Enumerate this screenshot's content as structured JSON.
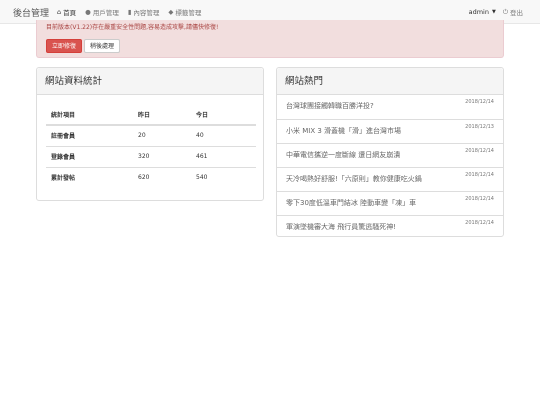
{
  "navbar": {
    "brand": "後台管理",
    "items": [
      {
        "icon": "home-icon",
        "label": "首頁"
      },
      {
        "icon": "user-icon",
        "label": "用戶管理"
      },
      {
        "icon": "file-icon",
        "label": "內容管理"
      },
      {
        "icon": "tag-icon",
        "label": "標籤管理"
      }
    ],
    "user": "admin",
    "logout": "登出"
  },
  "alert": {
    "text": "目前版本(V1.22)存在嚴重安全性問題,容易造成攻擊,請儘快修復!",
    "fix_button": "立即修復",
    "later_button": "稍後處理"
  },
  "stats": {
    "title": "網站資料統計",
    "headers": [
      "統計項目",
      "昨日",
      "今日"
    ],
    "rows": [
      [
        "註冊會員",
        "20",
        "40"
      ],
      [
        "登錄會員",
        "320",
        "461"
      ],
      [
        "累計發帖",
        "620",
        "540"
      ]
    ]
  },
  "hot": {
    "title": "網站熱門",
    "items": [
      {
        "title": "台灣球團接觸韓職百勝洋投?",
        "date": "2018/12/14"
      },
      {
        "title": "小米 MIX 3 滑蓋機「滑」進台灣市場",
        "date": "2018/12/13"
      },
      {
        "title": "中華電信攜逆一度斷線 遭日網友崩潰",
        "date": "2018/12/14"
      },
      {
        "title": "天冷喝熱好舒服!「六原則」教你健康吃火鍋",
        "date": "2018/12/14"
      },
      {
        "title": "零下30度低溫車門結冰 陸動車變「凍」車",
        "date": "2018/12/14"
      },
      {
        "title": "軍演墜機審大海 飛行員驚逃騷死神!",
        "date": "2018/12/14"
      }
    ]
  }
}
